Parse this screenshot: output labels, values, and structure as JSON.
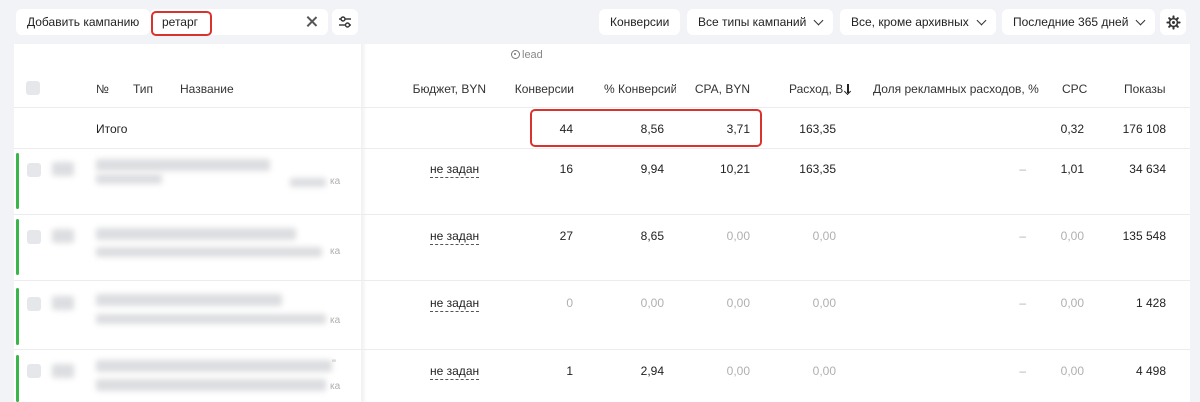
{
  "toolbar": {
    "add_campaign_label": "Добавить кампанию",
    "search_value": "ретарг",
    "conversions_label": "Конверсии",
    "campaign_types_label": "Все типы кампаний",
    "status_filter_label": "Все, кроме архивных",
    "period_label": "Последние 365 дней"
  },
  "goal": {
    "label": "lead"
  },
  "columns": {
    "number": "№",
    "type": "Тип",
    "name": "Название",
    "budget": "Бюджет, BYN",
    "conversions": "Конверсии",
    "conversion_rate": "% Конверсий",
    "cpa": "CPA, BYN",
    "spend": "Расход, B",
    "ad_share": "Доля рекламных расходов, %",
    "cpc": "CPC",
    "impressions": "Показы"
  },
  "totals": {
    "label": "Итого",
    "conversions": "44",
    "conversion_rate": "8,56",
    "cpa": "3,71",
    "spend": "163,35",
    "cpc": "0,32",
    "impressions": "176 108"
  },
  "rows": [
    {
      "name_tail": "ка",
      "budget": "не задан",
      "conversions": "16",
      "conversion_rate": "9,94",
      "cpa": "10,21",
      "spend": "163,35",
      "ad_share": "–",
      "cpc": "1,01",
      "impressions": "34 634"
    },
    {
      "name_tail": "ка",
      "budget": "не задан",
      "conversions": "27",
      "conversion_rate": "8,65",
      "cpa": "0,00",
      "spend": "0,00",
      "ad_share": "–",
      "cpc": "0,00",
      "impressions": "135 548"
    },
    {
      "name_tail": "ка",
      "budget": "не задан",
      "conversions": "0",
      "conversion_rate": "0,00",
      "cpa": "0,00",
      "spend": "0,00",
      "ad_share": "–",
      "cpc": "0,00",
      "impressions": "1 428"
    },
    {
      "name_tail": "ка",
      "name_mark": "\"",
      "budget": "не задан",
      "conversions": "1",
      "conversion_rate": "2,94",
      "cpa": "0,00",
      "spend": "0,00",
      "ad_share": "–",
      "cpc": "0,00",
      "impressions": "4 498"
    }
  ],
  "colors": {
    "highlight": "#d9332e",
    "active": "#3ab54a"
  },
  "icons": {
    "clear": "close-icon",
    "filter": "filter-settings-icon",
    "settings": "gear-icon",
    "goal": "target-icon",
    "sort": "sort-desc-icon"
  }
}
